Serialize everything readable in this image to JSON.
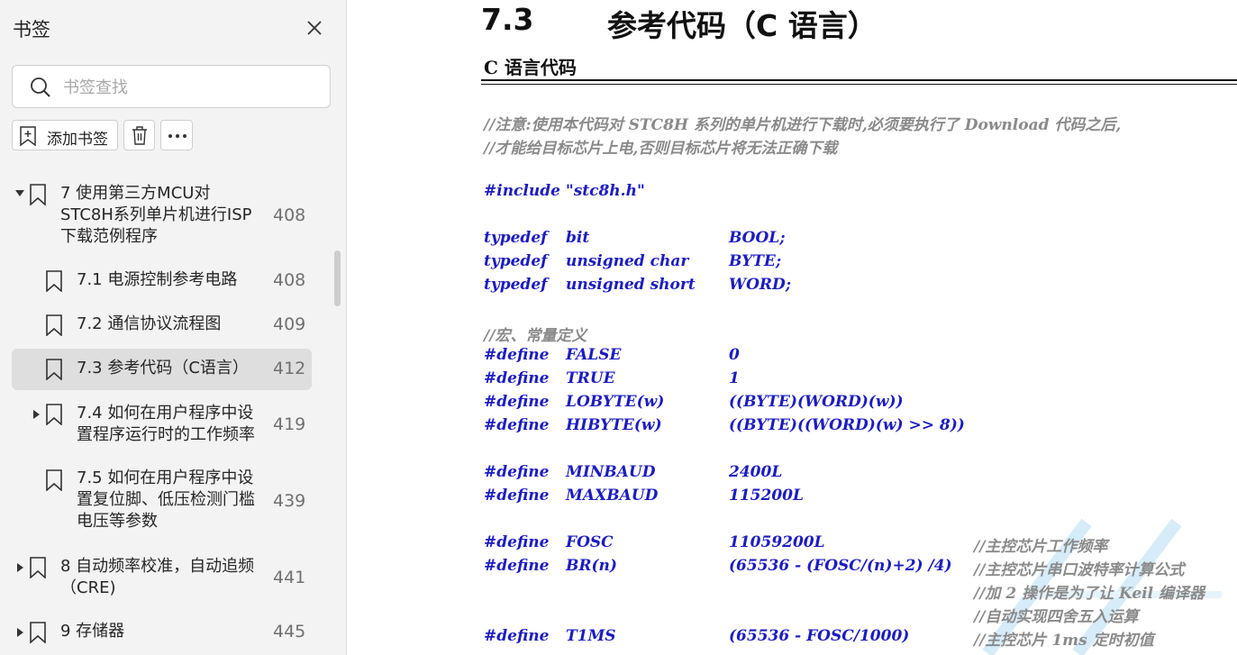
{
  "sidebar": {
    "title": "书签",
    "search_placeholder": "书签查找",
    "add_label": "添加书签",
    "bookmarks": [
      {
        "label": "7  使用第三方MCU对STC8H系列单片机进行ISP下载范例程序",
        "page": "408",
        "expander": "expanded"
      },
      {
        "label": "7.1 电源控制参考电路",
        "page": "408"
      },
      {
        "label": "7.2  通信协议流程图",
        "page": "409"
      },
      {
        "label": "7.3  参考代码（C语言）",
        "page": "412",
        "selected": true
      },
      {
        "label": "7.4  如何在用户程序中设置程序运行时的工作频率",
        "page": "419",
        "expander": "collapsed"
      },
      {
        "label": "7.5 如何在用户程序中设置复位脚、低压检测门槛电压等参数",
        "page": "439"
      },
      {
        "label": "8  自动频率校准，自动追频（CRE)",
        "page": "441",
        "expander": "collapsed"
      },
      {
        "label": "9  存储器",
        "page": "445",
        "expander": "collapsed"
      }
    ]
  },
  "doc": {
    "heading_num": "7.3",
    "heading_title": "参考代码（C 语言）",
    "subheading": "C 语言代码",
    "comment_1": "//注意:使用本代码对 STC8H 系列的单片机进行下载时,必须要执行了 Download 代码之后,",
    "comment_2": "//才能给目标芯片上电,否则目标芯片将无法正确下载",
    "include": "#include \"stc8h.h\"",
    "typedefs": [
      {
        "kw": "typedef",
        "type": "bit",
        "name": "BOOL;"
      },
      {
        "kw": "typedef",
        "type": "unsigned char",
        "name": "BYTE;"
      },
      {
        "kw": "typedef",
        "type": "unsigned short",
        "name": "WORD;"
      }
    ],
    "macro_comment": "//宏、常量定义",
    "defines_1": [
      {
        "kw": "#define",
        "name": "FALSE",
        "value": "0"
      },
      {
        "kw": "#define",
        "name": "TRUE",
        "value": "1"
      },
      {
        "kw": "#define",
        "name": "LOBYTE(w)",
        "value": "((BYTE)(WORD)(w))"
      },
      {
        "kw": "#define",
        "name": "HIBYTE(w)",
        "value": "((BYTE)((WORD)(w) >> 8))"
      }
    ],
    "defines_2": [
      {
        "kw": "#define",
        "name": "MINBAUD",
        "value": "2400L"
      },
      {
        "kw": "#define",
        "name": "MAXBAUD",
        "value": "115200L"
      }
    ],
    "defines_3": [
      {
        "kw": "#define",
        "name": "FOSC",
        "value": "11059200L",
        "comment": "//主控芯片工作频率"
      },
      {
        "kw": "#define",
        "name": "BR(n)",
        "value": "(65536 - (FOSC/(n)+2) /4)",
        "comment": "//主控芯片串口波特率计算公式"
      }
    ],
    "extra_comments": [
      "//加 2 操作是为了让 Keil 编译器",
      "//自动实现四舍五入运算"
    ],
    "define_t1ms": {
      "kw": "#define",
      "name": "T1MS",
      "value": "(65536 - FOSC/1000)",
      "comment": "//主控芯片 1ms 定时初值"
    }
  }
}
